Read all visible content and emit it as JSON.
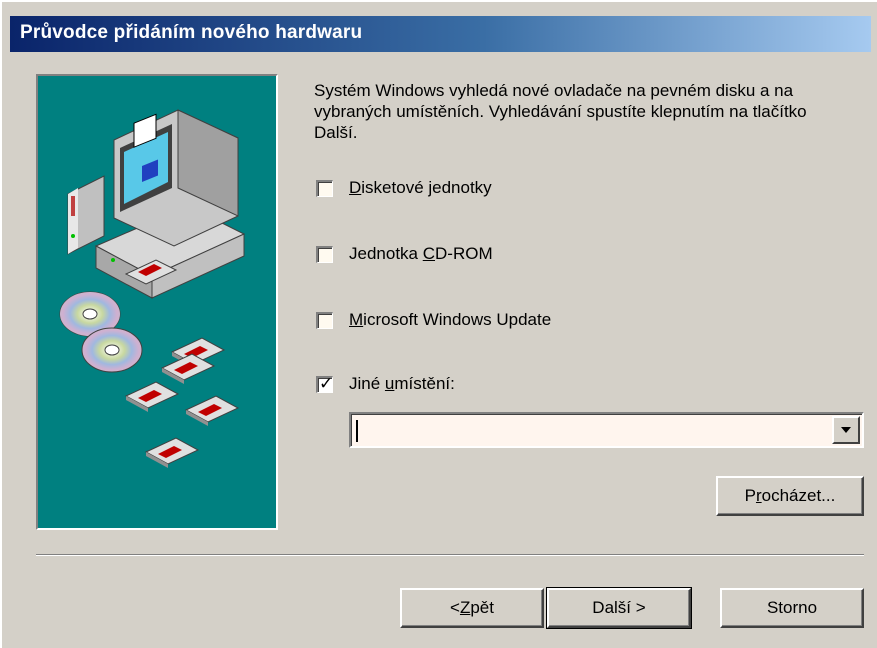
{
  "window": {
    "title": "Průvodce přidáním nového hardwaru"
  },
  "description": "Systém Windows vyhledá nové ovladače na pevném disku a na vybraných umístěních. Vyhledávání spustíte klepnutím na tlačítko Další.",
  "options": [
    {
      "label_pre": "",
      "label_key": "D",
      "label_post": "isketové jednotky",
      "checked": false
    },
    {
      "label_pre": "Jednotka ",
      "label_key": "C",
      "label_post": "D-ROM",
      "checked": false
    },
    {
      "label_pre": "",
      "label_key": "M",
      "label_post": "icrosoft Windows Update",
      "checked": false
    },
    {
      "label_pre": "Jiné ",
      "label_key": "u",
      "label_post": "místění:",
      "checked": true
    }
  ],
  "location": {
    "value": ""
  },
  "buttons": {
    "browse": {
      "pre": "P",
      "key": "r",
      "post": "ocházet..."
    },
    "back": {
      "pre": "< ",
      "key": "Z",
      "post": "pět"
    },
    "next": {
      "pre": "Další >",
      "key": "",
      "post": ""
    },
    "cancel": {
      "pre": "Storno",
      "key": "",
      "post": ""
    }
  },
  "icons": {
    "illustration": "hardware-wizard-illustration",
    "checkmark": "checkmark-icon",
    "dropdown": "chevron-down-icon"
  },
  "colors": {
    "title_gradient_start": "#0a246a",
    "title_gradient_end": "#a6caf0",
    "panel_teal": "#008080",
    "dialog_bg": "#d4d0c8"
  }
}
